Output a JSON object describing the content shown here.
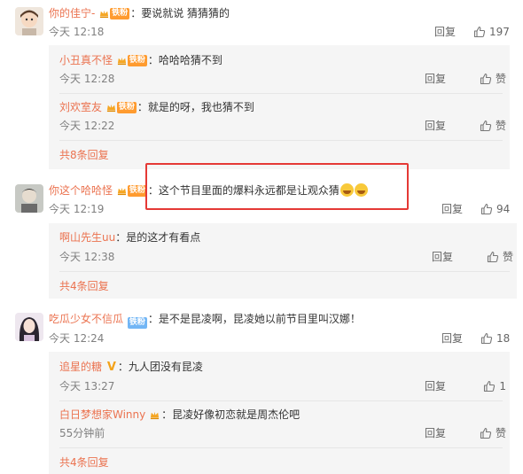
{
  "comments": [
    {
      "user": "你的佳宁-",
      "badge": "铁粉",
      "text": "要说就说  猜猜猜的",
      "time": "今天 12:18",
      "reply_label": "回复",
      "likes": "197",
      "subreplies": [
        {
          "user": "小丑真不怪",
          "badge": "铁粉",
          "text": "哈哈哈猜不到",
          "time": "今天 12:28",
          "reply_label": "回复",
          "likes": "赞"
        },
        {
          "user": "刘欢室友",
          "badge": "铁粉",
          "text": "就是的呀，我也猜不到",
          "time": "今天 12:22",
          "reply_label": "回复",
          "likes": "赞"
        }
      ],
      "more": "共8条回复"
    },
    {
      "user": "你这个哈哈怪",
      "badge": "铁粉",
      "text": "这个节目里面的爆料永远都是让观众猜",
      "time": "今天 12:19",
      "reply_label": "回复",
      "likes": "94",
      "subreplies": [
        {
          "user": "啊山先生uu",
          "badge": "",
          "text": "是的这才有看点",
          "time": "今天 12:38",
          "reply_label": "回复",
          "likes": "赞"
        }
      ],
      "more": "共4条回复"
    },
    {
      "user": "吃瓜少女不信瓜",
      "badge": "铁粉",
      "text": "是不是昆凌啊，昆凌她以前节目里叫汉娜！",
      "time": "今天 12:24",
      "reply_label": "回复",
      "likes": "18",
      "subreplies": [
        {
          "user": "追星的糖",
          "badge": "V",
          "text": "九人团没有昆凌",
          "time": "今天 13:27",
          "reply_label": "回复",
          "likes": "1"
        },
        {
          "user": "白日梦想家Winny",
          "badge": "crown",
          "text": "昆凌好像初恋就是周杰伦吧",
          "time": "55分钟前",
          "reply_label": "回复",
          "likes": "赞"
        }
      ],
      "more": "共4条回复"
    }
  ],
  "colors": {
    "username": "#eb7350",
    "highlight": "#e53935",
    "fan_badge": "#ff9b2f"
  },
  "icons": {
    "like": "thumbs-up-icon",
    "crown": "crown-icon",
    "verified": "v-verified-icon"
  }
}
